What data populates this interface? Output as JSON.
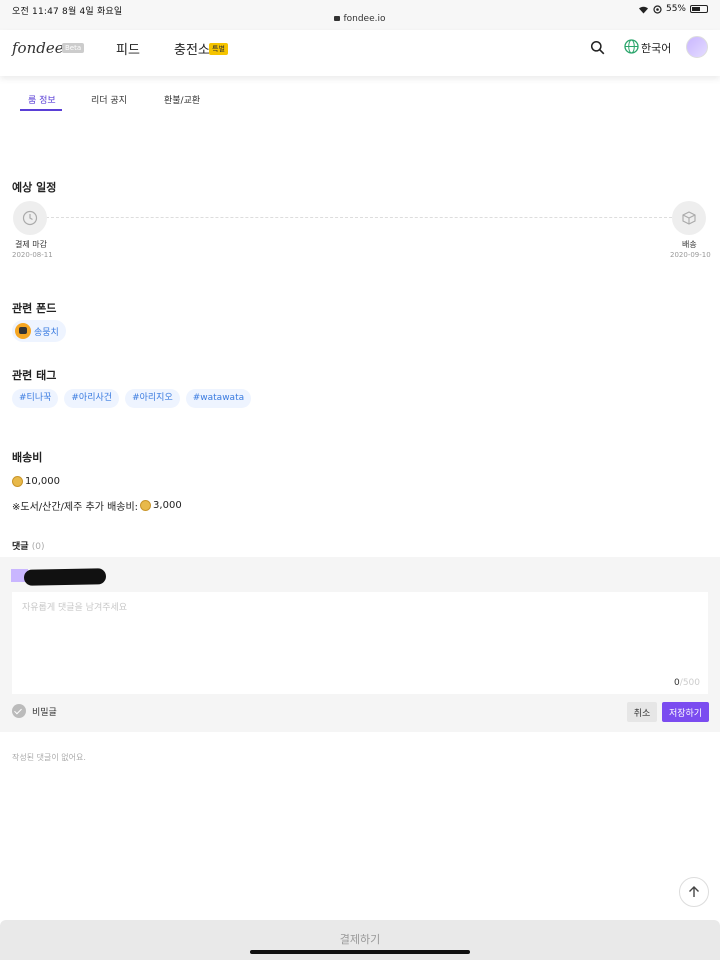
{
  "status_bar": {
    "time_date": "오전 11:47   8월 4일 화요일",
    "url": "fondee.io",
    "battery": "55%"
  },
  "header": {
    "logo": "fondee",
    "beta": "Beta",
    "nav_feed": "피드",
    "nav_charge": "충전소",
    "nav_badge": "특별",
    "language": "한국어"
  },
  "tabs": [
    {
      "label": "룸 정보",
      "active": true
    },
    {
      "label": "리더 공지",
      "active": false
    },
    {
      "label": "환불/교환",
      "active": false
    }
  ],
  "schedule": {
    "title": "예상 일정",
    "start_label": "결제 마감",
    "start_date": "2020-08-11",
    "end_label": "배송",
    "end_date": "2020-09-10"
  },
  "related_fund": {
    "title": "관련 폰드",
    "name": "송뭉치"
  },
  "related_tags": {
    "title": "관련 태그",
    "items": [
      "#티나꾹",
      "#아리사건",
      "#아리지오",
      "#watawata"
    ]
  },
  "shipping": {
    "title": "배송비",
    "fee": "10,000",
    "extra_label": "※도서/산간/제주 추가 배송비:",
    "extra_fee": "3,000"
  },
  "comments": {
    "title": "댓글",
    "count": "(0)",
    "placeholder": "자유롭게 댓글을 남겨주세요",
    "char_current": "0",
    "char_max": "/500",
    "secret_label": "비밀글",
    "cancel_label": "취소",
    "save_label": "저장하기",
    "empty_message": "작성된 댓글이 없어요."
  },
  "pay_button": "결제하기",
  "colors": {
    "accent": "#5a3fd6",
    "save_button": "#7b4cf0",
    "tag_text": "#3a7be0",
    "tag_bg": "#eef4ff"
  }
}
